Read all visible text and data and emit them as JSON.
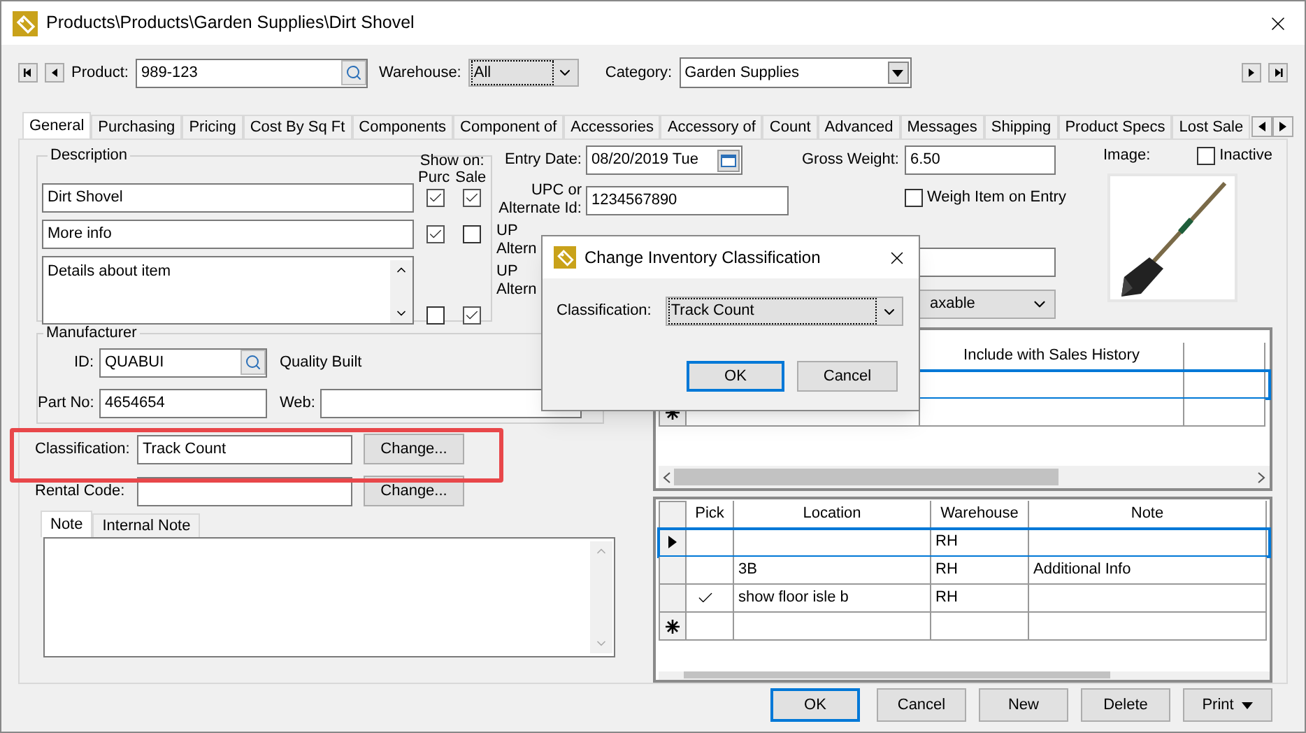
{
  "window": {
    "title": "Products\\Products\\Garden Supplies\\Dirt Shovel"
  },
  "toolbar": {
    "product_label": "Product:",
    "product": "989-123",
    "warehouse_label": "Warehouse:",
    "warehouse": "All",
    "category_label": "Category:",
    "category": "Garden Supplies"
  },
  "tabs": [
    {
      "label": "General",
      "selected": true
    },
    {
      "label": "Purchasing",
      "selected": false
    },
    {
      "label": "Pricing",
      "selected": false
    },
    {
      "label": "Cost By Sq Ft",
      "selected": false
    },
    {
      "label": "Components",
      "selected": false
    },
    {
      "label": "Component of",
      "selected": false
    },
    {
      "label": "Accessories",
      "selected": false
    },
    {
      "label": "Accessory of",
      "selected": false
    },
    {
      "label": "Count",
      "selected": false
    },
    {
      "label": "Advanced",
      "selected": false
    },
    {
      "label": "Messages",
      "selected": false
    },
    {
      "label": "Shipping",
      "selected": false
    },
    {
      "label": "Product Specs",
      "selected": false
    },
    {
      "label": "Lost Sale",
      "selected": false
    }
  ],
  "description": {
    "title": "Description",
    "show_on_label": "Show on:",
    "columns": [
      "Purc",
      "Sale"
    ],
    "lines": [
      {
        "kind": "line",
        "value": "Dirt Shovel",
        "purc": true,
        "sale": true
      },
      {
        "kind": "line",
        "value": "More info",
        "purc": true,
        "sale": false
      },
      {
        "kind": "memo",
        "value": "Details about item",
        "purc": false,
        "sale": true
      }
    ]
  },
  "dates": {
    "entry_date_label": "Entry Date:",
    "entry_date": "08/20/2019 Tue",
    "upc_label": [
      "UPC or",
      "Alternate Id:"
    ],
    "upc": "1234567890",
    "covered_labels": [
      [
        "UP",
        "Altern"
      ],
      [
        "UP",
        "Altern"
      ]
    ]
  },
  "weights": {
    "gross_weight_label": "Gross Weight:",
    "gross_weight": "6.50",
    "weigh_label": "Weigh Item on Entry",
    "weigh_on_entry": false,
    "tax_value": "axable"
  },
  "image": {
    "label": "Image:",
    "inactive_label": "Inactive",
    "inactive": false
  },
  "manufacturer": {
    "title": "Manufacturer",
    "id_label": "ID:",
    "id": "QUABUI",
    "name": "Quality Built",
    "part_label": "Part No:",
    "part_no": "4654654",
    "web_label": "Web:"
  },
  "classification": {
    "label": "Classification:",
    "value": "Track Count",
    "button": "Change..."
  },
  "rental": {
    "label": "Rental Code:",
    "button": "Change..."
  },
  "note_tabs": [
    {
      "label": "Note",
      "selected": true
    },
    {
      "label": "Internal Note",
      "selected": false
    }
  ],
  "history_grid": {
    "columns": [
      "Include with Sales History"
    ],
    "rows": [
      {
        "selected": true
      },
      {
        "selected": false,
        "new_row": true
      }
    ]
  },
  "locations": {
    "columns": [
      "Pick",
      "Location",
      "Warehouse",
      "Note"
    ],
    "rows": [
      {
        "selected": true,
        "new_row": false,
        "pick": false,
        "warehouse": "RH"
      },
      {
        "selected": false,
        "new_row": false,
        "pick": false,
        "location": "3B",
        "warehouse": "RH",
        "note": "Additional Info"
      },
      {
        "selected": false,
        "new_row": false,
        "pick": true,
        "location": "show floor isle b",
        "warehouse": "RH"
      },
      {
        "selected": false,
        "new_row": true,
        "pick": false
      }
    ]
  },
  "dialog": {
    "title": "Change Inventory Classification",
    "label": "Classification:",
    "value": "Track Count",
    "ok": "OK",
    "cancel": "Cancel"
  },
  "buttons": [
    {
      "kind": "default",
      "label": "OK"
    },
    {
      "kind": "plain",
      "label": "Cancel"
    },
    {
      "kind": "plain",
      "label": "New"
    },
    {
      "kind": "plain",
      "label": "Delete"
    },
    {
      "kind": "menu",
      "label": "Print"
    }
  ]
}
